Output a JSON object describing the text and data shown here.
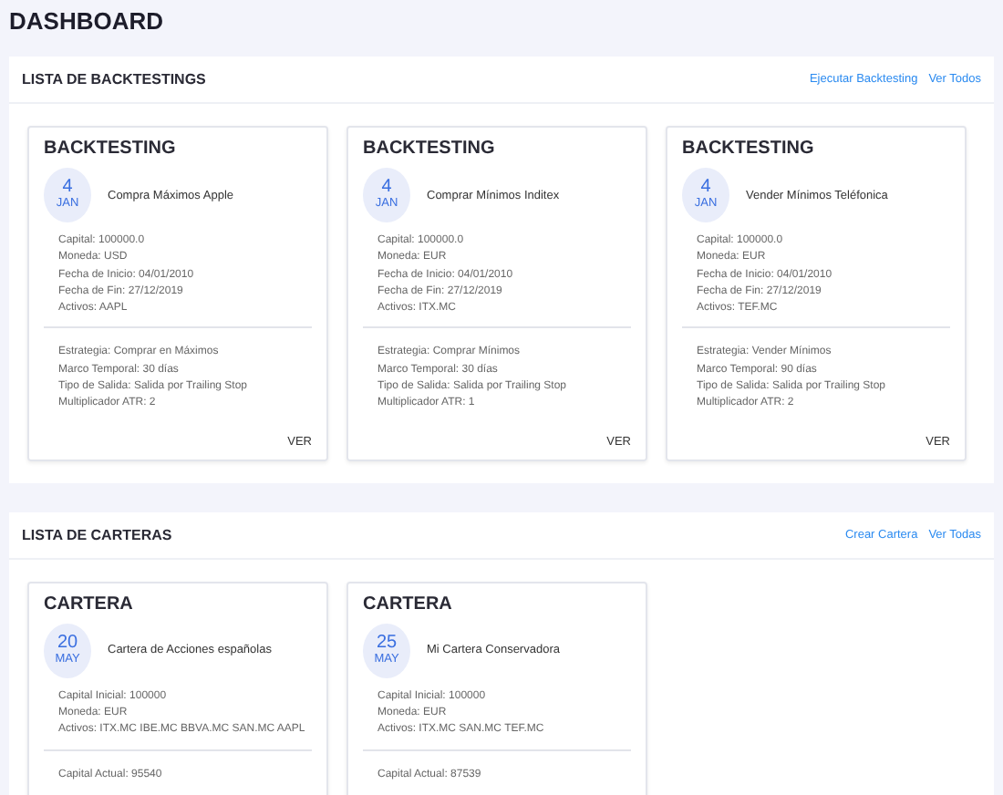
{
  "page_title": "DASHBOARD",
  "sections": [
    {
      "title": "LISTA DE BACKTESTINGS",
      "links": [
        "Ejecutar Backtesting",
        "Ver Todos"
      ],
      "cards": [
        {
          "heading": "BACKTESTING",
          "day": "4",
          "month": "JAN",
          "name": "Compra Máximos Apple",
          "details": [
            "Capital: 100000.0",
            "Moneda: USD",
            "Fecha de Inicio: 04/01/2010",
            "Fecha de Fin: 27/12/2019",
            "Activos: AAPL"
          ],
          "extra": [
            "Estrategia: Comprar en Máximos",
            "Marco Temporal: 30 días",
            "Tipo de Salida: Salida por Trailing Stop",
            "Multiplicador ATR: 2"
          ],
          "action": "VER"
        },
        {
          "heading": "BACKTESTING",
          "day": "4",
          "month": "JAN",
          "name": "Comprar Mínimos Inditex",
          "details": [
            "Capital: 100000.0",
            "Moneda: EUR",
            "Fecha de Inicio: 04/01/2010",
            "Fecha de Fin: 27/12/2019",
            "Activos: ITX.MC"
          ],
          "extra": [
            "Estrategia: Comprar Mínimos",
            "Marco Temporal: 30 días",
            "Tipo de Salida: Salida por Trailing Stop",
            "Multiplicador ATR: 1"
          ],
          "action": "VER"
        },
        {
          "heading": "BACKTESTING",
          "day": "4",
          "month": "JAN",
          "name": "Vender Mínimos Teléfonica",
          "details": [
            "Capital: 100000.0",
            "Moneda: EUR",
            "Fecha de Inicio: 04/01/2010",
            "Fecha de Fin: 27/12/2019",
            "Activos: TEF.MC"
          ],
          "extra": [
            "Estrategia: Vender Mínimos",
            "Marco Temporal: 90 días",
            "Tipo de Salida: Salida por Trailing Stop",
            "Multiplicador ATR: 2"
          ],
          "action": "VER"
        }
      ]
    },
    {
      "title": "LISTA DE CARTERAS",
      "links": [
        "Crear Cartera",
        "Ver Todas"
      ],
      "cards": [
        {
          "heading": "CARTERA",
          "day": "20",
          "month": "MAY",
          "name": "Cartera de Acciones españolas",
          "details": [
            "Capital Inicial: 100000",
            "Moneda: EUR",
            "Activos: ITX.MC IBE.MC BBVA.MC SAN.MC AAPL"
          ],
          "extra": [
            "Capital Actual: 95540"
          ]
        },
        {
          "heading": "CARTERA",
          "day": "25",
          "month": "MAY",
          "name": "Mi Cartera Conservadora",
          "details": [
            "Capital Inicial: 100000",
            "Moneda: EUR",
            "Activos: ITX.MC SAN.MC TEF.MC"
          ],
          "extra": [
            "Capital Actual: 87539"
          ]
        }
      ]
    }
  ]
}
